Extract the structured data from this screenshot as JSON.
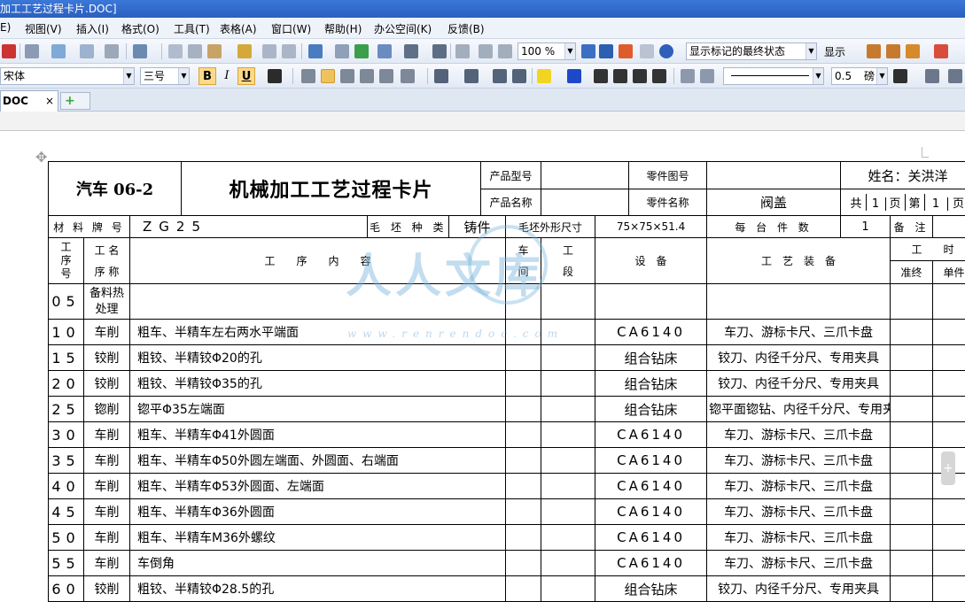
{
  "window": {
    "title": "加工工艺过程卡片.DOC]"
  },
  "menu": [
    "E)",
    "视图(V)",
    "插入(I)",
    "格式(O)",
    "工具(T)",
    "表格(A)",
    "窗口(W)",
    "帮助(H)",
    "办公空间(K)",
    "反馈(B)"
  ],
  "toolbar1": {
    "zoom": "100 %",
    "markup_mode": "显示标记的最终状态",
    "show_label": "显示"
  },
  "toolbar2": {
    "font_name": "宋体",
    "font_size": "三号",
    "bold": "B",
    "italic": "I",
    "underline": "U",
    "line_weight": "0.5",
    "line_unit": "磅"
  },
  "tabs": {
    "doc_label": "DOC",
    "close": "×",
    "new": "+"
  },
  "card": {
    "car": "汽车 06-2",
    "title": "机械加工工艺过程卡片",
    "product_model_label": "产品型号",
    "product_name_label": "产品名称",
    "part_drawing_label": "零件图号",
    "part_name_label": "零件名称",
    "part_name": "阀盖",
    "name_label": "姓名：关洪洋",
    "total": "共",
    "total_n": "1",
    "page": "页",
    "of": "第",
    "page_n": "1",
    "page2": "页",
    "material_label": "材 料 牌 号",
    "material": "ZG25",
    "blank_kind_label": "毛 坯 种 类",
    "blank_kind": "铸件",
    "blank_size_label": "毛坯外形尺寸",
    "blank_size": "75×75×51.4",
    "per_unit_label": "每 台 件 数",
    "per_unit": "1",
    "remark_label": "备 注",
    "col_seq": "工序号",
    "col_seq_l1": "工",
    "col_seq_l2": "序",
    "col_seq_l3": "号",
    "col_name_l1": "工 名",
    "col_name_l2": "序 称",
    "col_content": "工　　序　　内　　容",
    "col_shop_l1": "车",
    "col_shop_l2": "间",
    "col_sect_l1": "工",
    "col_sect_l2": "段",
    "col_equip": "设　备",
    "col_tool": "工　艺　装　备",
    "col_time": "工　　时",
    "col_prep": "准终",
    "col_unit": "单件",
    "rows": [
      {
        "no": "05",
        "name": "备料热处理",
        "content": "",
        "equip": "",
        "tool": ""
      },
      {
        "no": "10",
        "name": "车削",
        "content": "粗车、半精车左右两水平端面",
        "equip": "CA6140",
        "tool": "车刀、游标卡尺、三爪卡盘"
      },
      {
        "no": "15",
        "name": "铰削",
        "content": "粗铰、半精铰Φ20的孔",
        "equip": "组合钻床",
        "tool": "铰刀、内径千分尺、专用夹具"
      },
      {
        "no": "20",
        "name": "铰削",
        "content": "粗铰、半精铰Φ35的孔",
        "equip": "组合钻床",
        "tool": "铰刀、内径千分尺、专用夹具"
      },
      {
        "no": "25",
        "name": "锪削",
        "content": "锪平Φ35左端面",
        "equip": "组合钻床",
        "tool": "锪平面锪钻、内径千分尺、专用夹具"
      },
      {
        "no": "30",
        "name": "车削",
        "content": "粗车、半精车Φ41外圆面",
        "equip": "CA6140",
        "tool": "车刀、游标卡尺、三爪卡盘"
      },
      {
        "no": "35",
        "name": "车削",
        "content": "粗车、半精车Φ50外圆左端面、外圆面、右端面",
        "equip": "CA6140",
        "tool": "车刀、游标卡尺、三爪卡盘"
      },
      {
        "no": "40",
        "name": "车削",
        "content": "粗车、半精车Φ53外圆面、左端面",
        "equip": "CA6140",
        "tool": "车刀、游标卡尺、三爪卡盘"
      },
      {
        "no": "45",
        "name": "车削",
        "content": "粗车、半精车Φ36外圆面",
        "equip": "CA6140",
        "tool": "车刀、游标卡尺、三爪卡盘"
      },
      {
        "no": "50",
        "name": "车削",
        "content": "粗车、半精车M36外螺纹",
        "equip": "CA6140",
        "tool": "车刀、游标卡尺、三爪卡盘"
      },
      {
        "no": "55",
        "name": "车削",
        "content": "车倒角",
        "equip": "CA6140",
        "tool": "车刀、游标卡尺、三爪卡盘"
      },
      {
        "no": "60",
        "name": "铰削",
        "content": "粗铰、半精铰Φ28.5的孔",
        "equip": "组合钻床",
        "tool": "铰刀、内径千分尺、专用夹具"
      }
    ]
  },
  "watermark": {
    "text": "人人文库",
    "url": "www.renrendoc.com"
  },
  "colors": {
    "titlebar": "#2a5fbf",
    "menubar": "#eef3fa",
    "toolbar": "#e3eaf5",
    "watermark": "#78b4dc"
  },
  "icons": [
    "save-icon",
    "print-icon",
    "preview-icon",
    "cut-icon",
    "copy-icon",
    "paste-icon",
    "undo-icon",
    "redo-icon",
    "table-icon",
    "help-icon",
    "align-left-icon",
    "align-center-icon",
    "align-right-icon",
    "justify-icon",
    "highlight-icon",
    "font-color-icon",
    "border-icon"
  ]
}
